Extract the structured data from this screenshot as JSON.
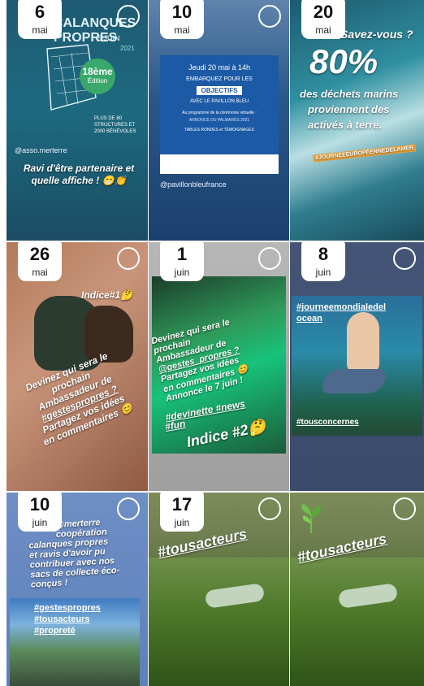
{
  "tiles": [
    {
      "day": "6",
      "month": "mai",
      "handle": "@asso.merterre",
      "caption": "Ravi d'être partenaire et quelle affiche ! 😁👏",
      "poster_title": "CALANQUES PROPRES",
      "poster_date": "5 JUIN",
      "poster_year": "2021",
      "badge_line1": "18ème",
      "badge_line2": "Édition",
      "poster_small": "PLUS DE 80 STRUCTURES ET 2000 BÉNÉVOLES"
    },
    {
      "day": "10",
      "month": "mai",
      "handle": "@pavillonbleufrance",
      "line1": "Jeudi 20 mai à 14h",
      "line2": "EMBARQUEZ POUR LES",
      "line3": "OBJECTIFS",
      "line4": "AVEC LE PAVILLON BLEU",
      "line5": "Au programme de la cérémonie virtuelle :",
      "line6": "ANNONCE DU PALMARÈS 2021",
      "line7": "TABLES RONDES et TÉMOIGNAGES"
    },
    {
      "day": "20",
      "month": "mai",
      "top_text": "Savez-vous ?",
      "big_text": "80%",
      "line1": "des déchets marins",
      "line2": "proviennent des",
      "line3": "activés à terre.",
      "hashtag": "#JOURNÉEEUROPÉENNEDELAMER"
    },
    {
      "day": "26",
      "month": "mai",
      "indice": "Indice#1🤔",
      "line1": "Devinez qui sera le",
      "line2": "prochain",
      "line3": "Ambassadeur de",
      "line4": "#gestespropres ?",
      "line5": "Partagez vos idées",
      "line6": "en commentaires 😊"
    },
    {
      "day": "1",
      "month": "juin",
      "line1": "Devinez qui sera le",
      "line2": "prochain",
      "line3": "Ambassadeur de",
      "line4": "@gestes_propres ?",
      "line5": "Partagez vos idées",
      "line6": "en commentaires 😊",
      "line7": "Annonce le 7 juin !",
      "tags": "#devinette #news",
      "tag2": "#fun",
      "indice": "Indice #2🤔"
    },
    {
      "day": "8",
      "month": "juin",
      "tag1": "#journeemondialedel",
      "tag2": "ocean",
      "tag3": "#tousconcernes"
    },
    {
      "day": "10",
      "month": "juin",
      "line1": "@merterre",
      "line2": "coopération",
      "line3": "calanques propres",
      "line4": "et ravis d'avoir pu",
      "line5": "contribuer avec nos",
      "line6": "sacs de collecte éco-",
      "line7": "conçus !",
      "tag1": "#gestespropres",
      "tag2": "#tousacteurs",
      "tag3": "#propreté"
    },
    {
      "day": "17",
      "month": "juin",
      "tag": "#tousacteurs"
    },
    {
      "tag": "#tousacteurs"
    }
  ]
}
